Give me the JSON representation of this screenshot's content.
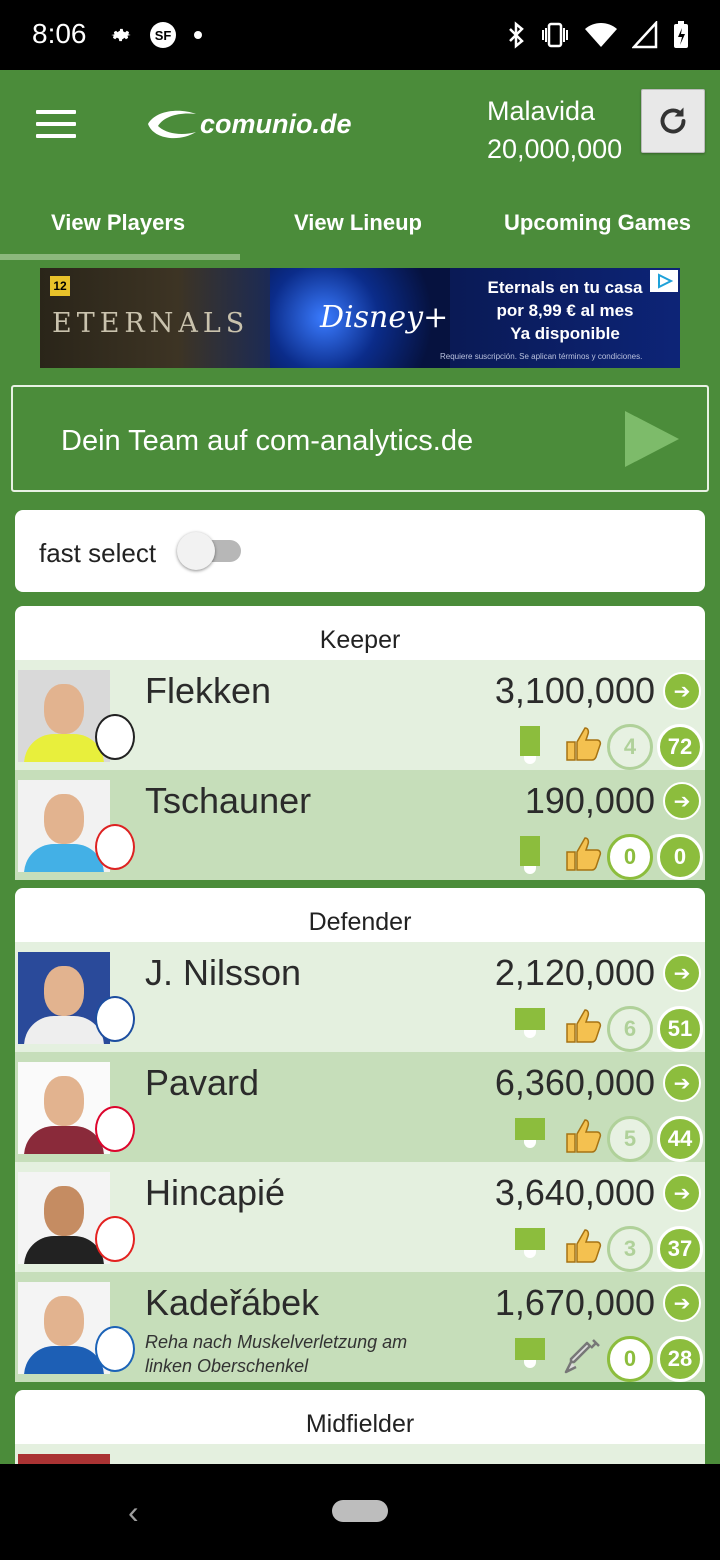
{
  "status_bar": {
    "time": "8:06",
    "icons_left": [
      "gear-icon",
      "sf-icon",
      "dot-icon"
    ],
    "icons_right": [
      "bluetooth-icon",
      "vibrate-icon",
      "wifi-icon",
      "signal-icon",
      "battery-icon"
    ]
  },
  "header": {
    "logo_text": "comunio.de",
    "user_name": "Malavida",
    "budget": "20,000,000"
  },
  "tabs": [
    {
      "label": "View Players",
      "active": true
    },
    {
      "label": "View Lineup",
      "active": false
    },
    {
      "label": "Upcoming Games",
      "active": false
    }
  ],
  "ad_banner": {
    "rating": "12",
    "title": "ETERNALS",
    "brand": "Disney+",
    "promo_line1": "Eternals en tu casa",
    "promo_line2": "por 8,99 € al mes",
    "promo_line3": "Ya disponible",
    "fine_print": "Requiere suscripción. Se aplican términos y condiciones."
  },
  "analytics": {
    "label": "Dein Team auf com-analytics.de"
  },
  "fast_select": {
    "label": "fast select",
    "enabled": false
  },
  "sections": [
    {
      "title": "Keeper",
      "players": [
        {
          "name": "Flekken",
          "price": "3,100,000",
          "note": "",
          "score": "4",
          "points": "72",
          "icon": "thumbs-up-icon",
          "shade": "light"
        },
        {
          "name": "Tschauner",
          "price": "190,000",
          "note": "",
          "score": "0",
          "points": "0",
          "icon": "thumbs-up-icon",
          "shade": "dark"
        }
      ]
    },
    {
      "title": "Defender",
      "players": [
        {
          "name": "J. Nilsson",
          "price": "2,120,000",
          "note": "",
          "score": "6",
          "points": "51",
          "icon": "thumbs-up-icon",
          "shade": "light"
        },
        {
          "name": "Pavard",
          "price": "6,360,000",
          "note": "",
          "score": "5",
          "points": "44",
          "icon": "thumbs-up-icon",
          "shade": "dark"
        },
        {
          "name": "Hincapié",
          "price": "3,640,000",
          "note": "",
          "score": "3",
          "points": "37",
          "icon": "thumbs-up-icon",
          "shade": "light"
        },
        {
          "name": "Kadeřábek",
          "price": "1,670,000",
          "note": "Reha nach Muskelverletzung am linken Oberschenkel",
          "score": "0",
          "points": "28",
          "icon": "syringe-icon",
          "shade": "dark"
        }
      ]
    },
    {
      "title": "Midfielder",
      "players": []
    }
  ],
  "colors": {
    "app_green": "#4b8c3a",
    "accent_green": "#8cbd3d",
    "row_light": "#e4f0df",
    "row_dark": "#c6deba"
  }
}
